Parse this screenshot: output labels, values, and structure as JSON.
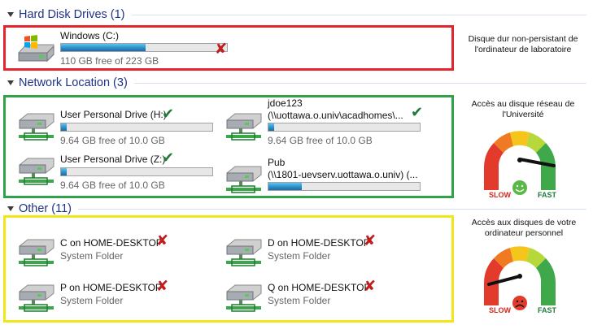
{
  "sections": {
    "hard_disk": {
      "title": "Hard Disk Drives (1)",
      "drives": [
        {
          "name": "Windows (C:)",
          "free_text": "110 GB free of 223 GB",
          "used_fraction": 0.51,
          "status": "x"
        }
      ],
      "note": "Disque dur non-persistant de l'ordinateur de laboratoire",
      "border_color": "#e2262b"
    },
    "network": {
      "title": "Network Location (3)",
      "drives": [
        {
          "name": "User Personal Drive (H:)",
          "free_text": "9.64 GB free of 10.0 GB",
          "used_fraction": 0.04,
          "status": "check"
        },
        {
          "name_line1": "jdoe123",
          "name_line2": "(\\\\uottawa.o.univ\\acadhomes\\...",
          "free_text": "9.64 GB free of 10.0 GB",
          "used_fraction": 0.04,
          "status": "check"
        },
        {
          "name": "User Personal Drive (Z:)",
          "free_text": "9.64 GB free of 10.0 GB",
          "used_fraction": 0.04,
          "status": "check"
        },
        {
          "name_line1": "Pub",
          "name_line2": "(\\\\1801-uevserv.uottawa.o.univ) (...",
          "used_fraction": 0.22
        }
      ],
      "note": "Accès au disque réseau de l'Université",
      "border_color": "#2fa24a",
      "gauge": {
        "slow_label": "SLOW",
        "fast_label": "FAST",
        "level": 0.85,
        "face": "smile"
      }
    },
    "other": {
      "title": "Other (11)",
      "drives": [
        {
          "name": "C on HOME-DESKTOP",
          "sub": "System Folder",
          "status": "x"
        },
        {
          "name": "D on HOME-DESKTOP",
          "sub": "System Folder",
          "status": "x"
        },
        {
          "name": "P on HOME-DESKTOP",
          "sub": "System Folder",
          "status": "x"
        },
        {
          "name": "Q on HOME-DESKTOP",
          "sub": "System Folder",
          "status": "x"
        }
      ],
      "note": "Accès aux disques de votre ordinateur personnel",
      "border_color": "#f2e61b",
      "gauge": {
        "slow_label": "SLOW",
        "fast_label": "FAST",
        "level": 0.12,
        "face": "frown"
      }
    }
  },
  "colors": {
    "header_text": "#1e3287",
    "check": "#1f7a3a",
    "x_mark": "#c21d1d"
  },
  "icons": {
    "section_toggle": "triangle-down-icon",
    "windows_drive": "windows-drive-icon",
    "network_drive": "network-drive-icon",
    "status_check": "check-icon",
    "status_x": "x-mark-icon"
  }
}
